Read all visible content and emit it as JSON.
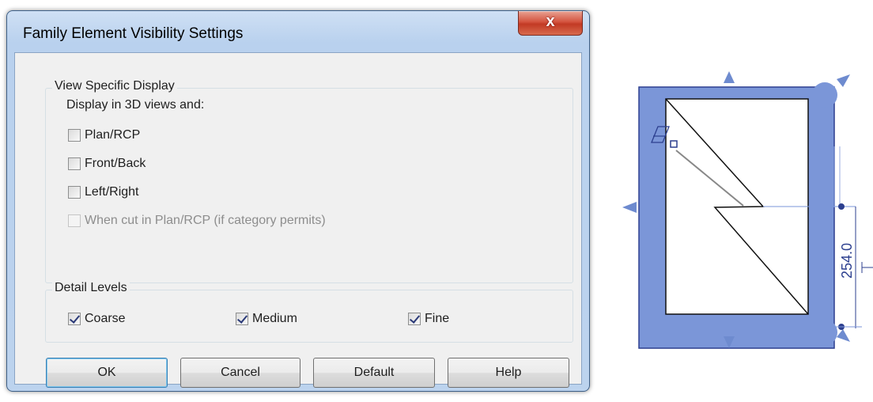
{
  "dialog": {
    "title": "Family Element Visibility Settings",
    "close_glyph": "x"
  },
  "view_specific": {
    "legend": "View Specific Display",
    "subtitle": "Display in 3D views and:",
    "options": [
      {
        "label": "Plan/RCP",
        "checked": false,
        "enabled": true
      },
      {
        "label": "Front/Back",
        "checked": false,
        "enabled": true
      },
      {
        "label": "Left/Right",
        "checked": false,
        "enabled": true
      },
      {
        "label": "When cut in Plan/RCP (if category permits)",
        "checked": false,
        "enabled": false
      }
    ]
  },
  "detail_levels": {
    "legend": "Detail Levels",
    "options": [
      {
        "label": "Coarse",
        "checked": true
      },
      {
        "label": "Medium",
        "checked": true
      },
      {
        "label": "Fine",
        "checked": true
      }
    ]
  },
  "buttons": {
    "ok": "OK",
    "cancel": "Cancel",
    "default": "Default",
    "help": "Help"
  },
  "drawing": {
    "dimension_text": "254.0",
    "fill_color": "#7b96d8",
    "line_color": "#2c3f8f"
  }
}
